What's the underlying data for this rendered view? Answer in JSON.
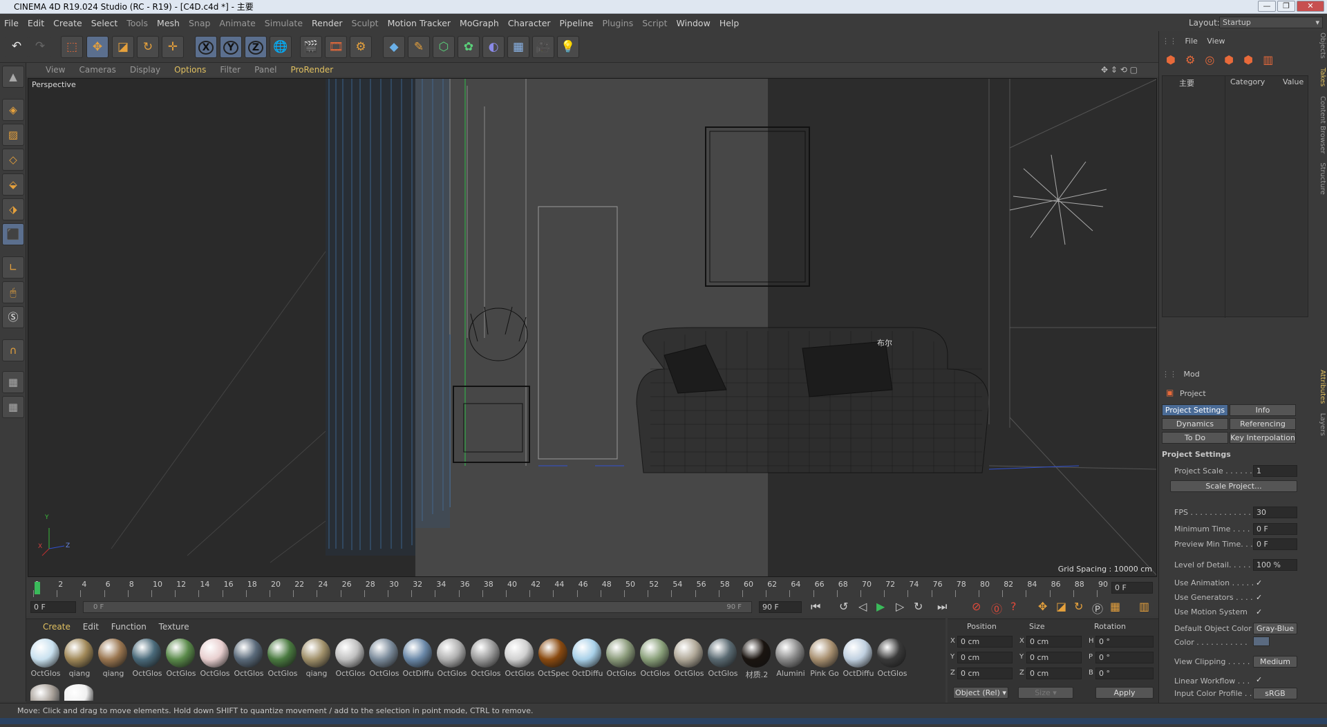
{
  "window": {
    "title": "CINEMA 4D R19.024 Studio (RC - R19) - [C4D.c4d *] - 主要"
  },
  "menu": [
    "File",
    "Edit",
    "Create",
    "Select",
    "Tools",
    "Mesh",
    "Snap",
    "Animate",
    "Simulate",
    "Render",
    "Sculpt",
    "Motion Tracker",
    "MoGraph",
    "Character",
    "Pipeline",
    "Plugins",
    "Script",
    "Window",
    "Help"
  ],
  "layout": {
    "label": "Layout:",
    "value": "Startup"
  },
  "toolbar_icons": [
    "undo-icon",
    "redo-icon",
    "live-selection-icon",
    "move-icon",
    "scale-icon",
    "rotate-icon",
    "multi-tool-icon",
    "x-axis-icon",
    "y-axis-icon",
    "z-axis-icon",
    "world-coords-icon",
    "render-view-icon",
    "render-picture-viewer-icon",
    "edit-render-settings-icon",
    "cube-icon",
    "pen-icon",
    "subdivision-icon",
    "cloner-icon",
    "deformer-icon",
    "floor-icon",
    "camera-icon",
    "light-icon"
  ],
  "axis_labels": {
    "x": "X",
    "y": "Y",
    "z": "Z"
  },
  "viewport_menu": [
    "View",
    "Cameras",
    "Display",
    "Options",
    "Filter",
    "Panel",
    "ProRender"
  ],
  "viewport": {
    "label": "Perspective",
    "grid_spacing": "Grid Spacing : 10000 cm",
    "annotation": "布尔"
  },
  "timeline": {
    "ticks": [
      "0",
      "2",
      "4",
      "6",
      "8",
      "10",
      "12",
      "14",
      "16",
      "18",
      "20",
      "22",
      "24",
      "26",
      "28",
      "30",
      "32",
      "34",
      "36",
      "38",
      "40",
      "42",
      "44",
      "46",
      "48",
      "50",
      "52",
      "54",
      "56",
      "58",
      "60",
      "62",
      "64",
      "66",
      "68",
      "70",
      "72",
      "74",
      "76",
      "78",
      "80",
      "82",
      "84",
      "86",
      "88",
      "90"
    ],
    "current_frame": "0 F",
    "start_frame": "0 F",
    "range_start": "0 F",
    "range_end": "90 F",
    "end_frame": "90 F"
  },
  "material_tabs": [
    "Create",
    "Edit",
    "Function",
    "Texture"
  ],
  "materials": [
    {
      "name": "OctGlos",
      "color": "#c9e1ef"
    },
    {
      "name": "qiang",
      "color": "#a08858"
    },
    {
      "name": "qiang",
      "color": "#9a7650"
    },
    {
      "name": "OctGlos",
      "color": "#4a6a7a"
    },
    {
      "name": "OctGlos",
      "color": "#5a8a4a"
    },
    {
      "name": "OctGlos",
      "color": "#e8cfcf"
    },
    {
      "name": "OctGlos",
      "color": "#5a6a7a"
    },
    {
      "name": "OctGlos",
      "color": "#4a7a40"
    },
    {
      "name": "qiang",
      "color": "#a0906a"
    },
    {
      "name": "OctGlos",
      "color": "#c0c0c0"
    },
    {
      "name": "OctGlos",
      "color": "#7a8a9a"
    },
    {
      "name": "OctDiffu",
      "color": "#6a88a8"
    },
    {
      "name": "OctGlos",
      "color": "#b0b0b0"
    },
    {
      "name": "OctGlos",
      "color": "#9a9a9a"
    },
    {
      "name": "OctGlos",
      "color": "#d0d0d0"
    },
    {
      "name": "OctSpec",
      "color": "#8a4a10"
    },
    {
      "name": "OctDiffu",
      "color": "#a8d0e8"
    },
    {
      "name": "OctGlos",
      "color": "#8a9a7a"
    },
    {
      "name": "OctGlos",
      "color": "#8aa07a"
    },
    {
      "name": "OctGlos",
      "color": "#b0a898"
    },
    {
      "name": "OctGlos",
      "color": "#5a6a72"
    },
    {
      "name": "材质.2",
      "color": "#1a1410"
    },
    {
      "name": "Alumini",
      "color": "#8a8a8a"
    },
    {
      "name": "Pink Go",
      "color": "#a89070"
    },
    {
      "name": "OctDiffu",
      "color": "#c0d0e0"
    },
    {
      "name": "OctGlos",
      "color": "#3a3a3a"
    }
  ],
  "materials_row2": [
    {
      "color": "#a8a098"
    },
    {
      "color": "#f0f0f0"
    }
  ],
  "coords": {
    "headers": [
      "Position",
      "Size",
      "Rotation"
    ],
    "rows": [
      {
        "axis": "X",
        "pos": "0 cm",
        "size_axis": "X",
        "size": "0 cm",
        "rot_axis": "H",
        "rot": "0 °"
      },
      {
        "axis": "Y",
        "pos": "0 cm",
        "size_axis": "Y",
        "size": "0 cm",
        "rot_axis": "P",
        "rot": "0 °"
      },
      {
        "axis": "Z",
        "pos": "0 cm",
        "size_axis": "Z",
        "size": "0 cm",
        "rot_axis": "B",
        "rot": "0 °"
      }
    ],
    "mode": "Object (Rel)",
    "size_mode": "Size",
    "apply": "Apply"
  },
  "object_manager": {
    "menu": [
      "File",
      "View"
    ],
    "root_label": "主要",
    "col_category": "Category",
    "col_value": "Value"
  },
  "side_tabs_top": [
    "Objects",
    "Takes",
    "Content Browser",
    "Structure"
  ],
  "side_tabs_bottom": [
    "Attributes",
    "Layers"
  ],
  "attributes": {
    "mode": "Mod",
    "object": "Project",
    "tabs": [
      "Project Settings",
      "Info",
      "Dynamics",
      "Referencing",
      "To Do",
      "Key Interpolation"
    ],
    "section": "Project Settings",
    "fields": [
      {
        "label": "Project Scale . . . . . .",
        "value": "1"
      },
      {
        "label": "FPS . . . . . . . . . . . . . .",
        "value": "30"
      },
      {
        "label": "Minimum Time . . . . .",
        "value": "0 F"
      },
      {
        "label": "Preview Min Time. . .",
        "value": "0 F"
      },
      {
        "label": "Level of Detail. . . . . .",
        "value": "100 %"
      }
    ],
    "scale_button": "Scale Project...",
    "checks": [
      {
        "label": "Use Animation . . . . .",
        "value": "✓"
      },
      {
        "label": "Use Generators . . . .",
        "value": "✓"
      },
      {
        "label": "Use Motion System",
        "value": "✓"
      }
    ],
    "default_color_label": "Default Object Color",
    "default_color_value": "Gray-Blue",
    "color_label": "Color . . . . . . . . . . .",
    "view_clipping_label": "View Clipping . . . . . .",
    "view_clipping_value": "Medium",
    "linear_workflow_label": "Linear Workflow . . .",
    "linear_workflow_value": "✓",
    "input_profile_label": "Input Color Profile . .",
    "input_profile_value": "sRGB"
  },
  "status": "Move: Click and drag to move elements. Hold down SHIFT to quantize movement / add to the selection in point mode, CTRL to remove.",
  "colors": {
    "accent_blue": "#4a6b96",
    "bg": "#3a3a3a",
    "viewport_dark": "#2a2a2a",
    "viewport_mid": "#474747"
  }
}
